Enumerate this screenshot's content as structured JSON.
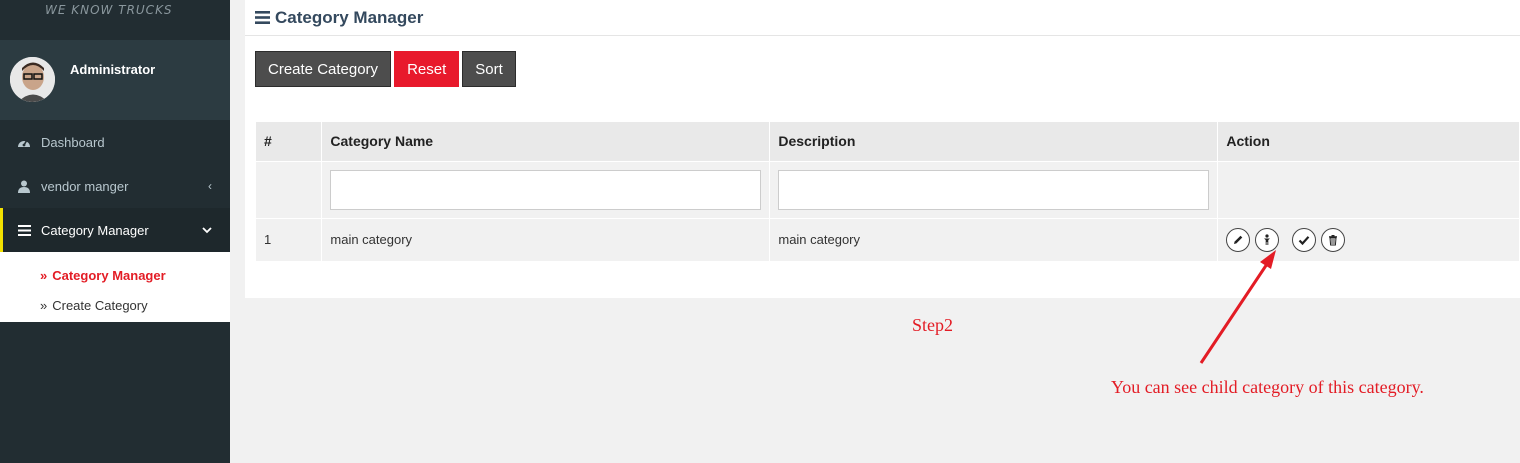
{
  "brand": {
    "tagline": "WE KNOW TRUCKS"
  },
  "user": {
    "name": "Administrator",
    "avatar_icon": "avatar-photo"
  },
  "sidebar": {
    "items": [
      {
        "label": "Dashboard",
        "icon": "dashboard-icon"
      },
      {
        "label": "vendor manger",
        "icon": "user-icon",
        "caret": "‹"
      },
      {
        "label": "Category Manager",
        "icon": "bars-icon",
        "caret": "⌄"
      }
    ],
    "subitems": [
      {
        "label": "Category Manager",
        "chevron": "»"
      },
      {
        "label": "Create Category",
        "chevron": "»"
      }
    ],
    "active_color": "#e31c25",
    "accent_color": "#f3e100"
  },
  "page": {
    "title": "Category Manager"
  },
  "toolbar": {
    "create_label": "Create Category",
    "reset_label": "Reset",
    "sort_label": "Sort"
  },
  "table": {
    "columns": [
      "#",
      "Category Name",
      "Description",
      "Action"
    ],
    "filters": {
      "name_value": "",
      "description_value": ""
    },
    "rows": [
      {
        "index": "1",
        "name": "main category",
        "description": "main category"
      }
    ],
    "actions": [
      "edit-icon",
      "child-category-icon",
      "check-icon",
      "trash-icon"
    ]
  },
  "annotation": {
    "step": "Step2",
    "note": "You can see child category of this category.",
    "color": "#e31c25"
  }
}
